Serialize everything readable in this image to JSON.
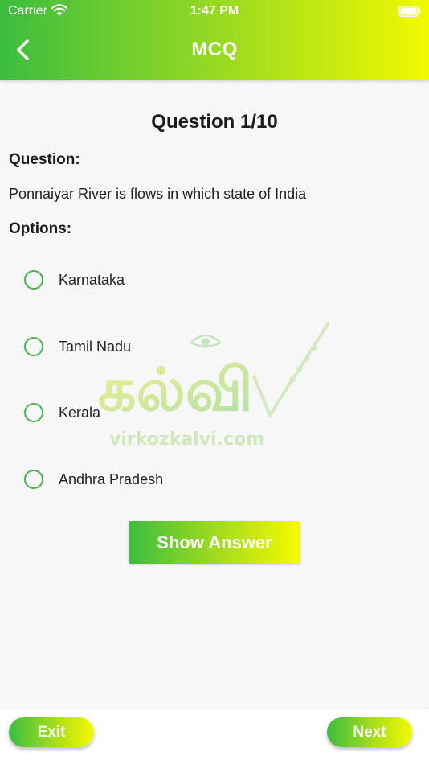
{
  "status_bar": {
    "carrier": "Carrier",
    "time": "1:47 PM",
    "icons": [
      "wifi-icon",
      "battery-icon"
    ]
  },
  "header": {
    "title": "MCQ",
    "back_icon": "chevron-left-icon"
  },
  "question": {
    "counter": "Question 1/10",
    "label": "Question:",
    "text": "Ponnaiyar River is flows in which state of India"
  },
  "options": {
    "label": "Options:",
    "items": [
      {
        "text": "Karnataka",
        "selected": false
      },
      {
        "text": "Tamil Nadu",
        "selected": false
      },
      {
        "text": "Kerala",
        "selected": false
      },
      {
        "text": "Andhra Pradesh",
        "selected": false
      }
    ]
  },
  "watermark": {
    "logo_text": "கல்வி",
    "site": "virkozkalvi.com"
  },
  "actions": {
    "show_answer": "Show Answer",
    "exit": "Exit",
    "next": "Next"
  },
  "colors": {
    "gradient_start": "#3bbd3f",
    "gradient_end": "#f6f900",
    "radio": "#4caf50"
  }
}
